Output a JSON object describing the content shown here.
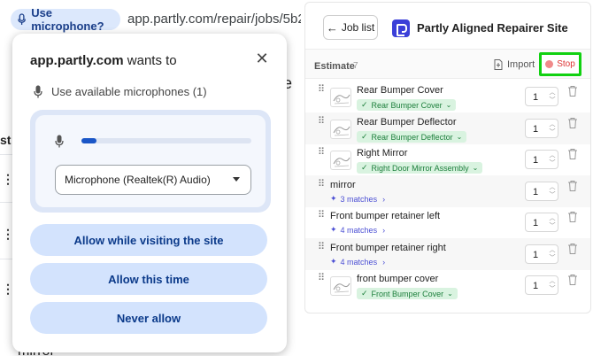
{
  "browser": {
    "mic_chip_label": "Use microphone?",
    "url": "app.partly.com/repair/jobs/5b2"
  },
  "background_fragments": {
    "letter_e": "e",
    "letters_st": "st",
    "mirror_text": "mirror"
  },
  "permission_popup": {
    "site": "app.partly.com",
    "wants_to": "wants to",
    "permission_text": "Use available microphones (1)",
    "mic_level": 0.09,
    "selected_mic": "Microphone (Realtek(R) Audio)",
    "buttons": {
      "allow_visit": "Allow while visiting the site",
      "allow_once": "Allow this time",
      "never": "Never allow"
    }
  },
  "panel": {
    "job_list_label": "Job list",
    "site_title": "Partly Aligned Repairer Site",
    "estimate_label": "Estimate",
    "estimate_count": "7",
    "import_label": "Import",
    "stop_label": "Stop",
    "items": [
      {
        "name": "Rear Bumper Cover",
        "tag": "Rear Bumper Cover",
        "matches": "",
        "qty": "1"
      },
      {
        "name": "Rear Bumper Deflector",
        "tag": "Rear Bumper Deflector",
        "matches": "",
        "qty": "1"
      },
      {
        "name": "Right Mirror",
        "tag": "Right Door Mirror Assembly",
        "matches": "",
        "qty": "1"
      },
      {
        "name": "mirror",
        "tag": "",
        "matches": "3 matches",
        "qty": "1"
      },
      {
        "name": "Front bumper retainer left",
        "tag": "",
        "matches": "4 matches",
        "qty": "1"
      },
      {
        "name": "Front bumper retainer right",
        "tag": "",
        "matches": "4 matches",
        "qty": "1"
      },
      {
        "name": "front bumper cover",
        "tag": "Front Bumper Cover",
        "matches": "",
        "qty": "1"
      }
    ]
  },
  "colors": {
    "chip_bg": "#dce8fc",
    "popup_button_bg": "#d3e3fd",
    "tag_bg": "#d9f3e0",
    "tag_text": "#1d7f3c",
    "matches_text": "#4b4fd4",
    "stop_highlight": "#11d111"
  }
}
